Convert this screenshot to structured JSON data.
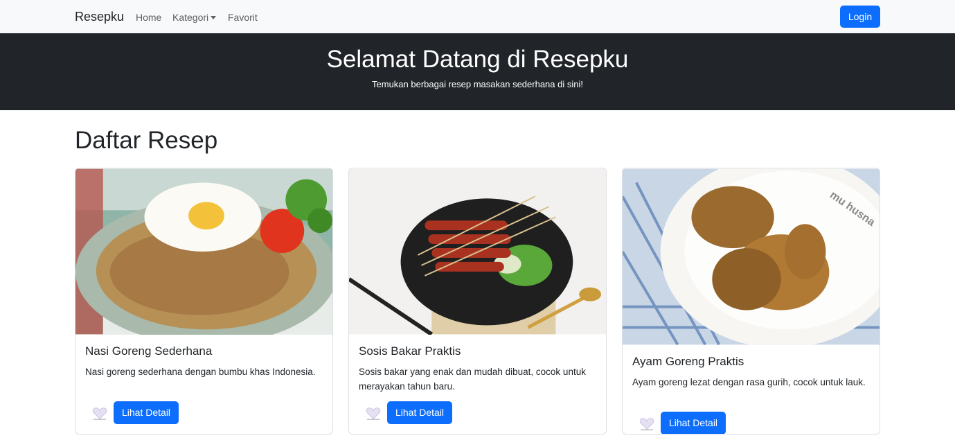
{
  "navbar": {
    "brand": "Resepku",
    "links": [
      {
        "label": "Home"
      },
      {
        "label": "Kategori"
      },
      {
        "label": "Favorit"
      }
    ],
    "login_label": "Login"
  },
  "hero": {
    "title": "Selamat Datang di Resepku",
    "subtitle": "Temukan berbagai resep masakan sederhana di sini!"
  },
  "section_title": "Daftar Resep",
  "recipes": [
    {
      "title": "Nasi Goreng Sederhana",
      "description": "Nasi goreng sederhana dengan bumbu khas Indonesia.",
      "button": "Lihat Detail"
    },
    {
      "title": "Sosis Bakar Praktis",
      "description": "Sosis bakar yang enak dan mudah dibuat, cocok untuk merayakan tahun baru.",
      "button": "Lihat Detail"
    },
    {
      "title": "Ayam Goreng Praktis",
      "description": "Ayam goreng lezat dengan rasa gurih, cocok untuk lauk.",
      "button": "Lihat Detail",
      "watermark": "mu husna"
    }
  ],
  "colors": {
    "primary": "#0d6efd",
    "hero_bg": "#212529",
    "navbar_bg": "#f8f9fa"
  },
  "icons": {
    "favorite": "heart-icon"
  }
}
